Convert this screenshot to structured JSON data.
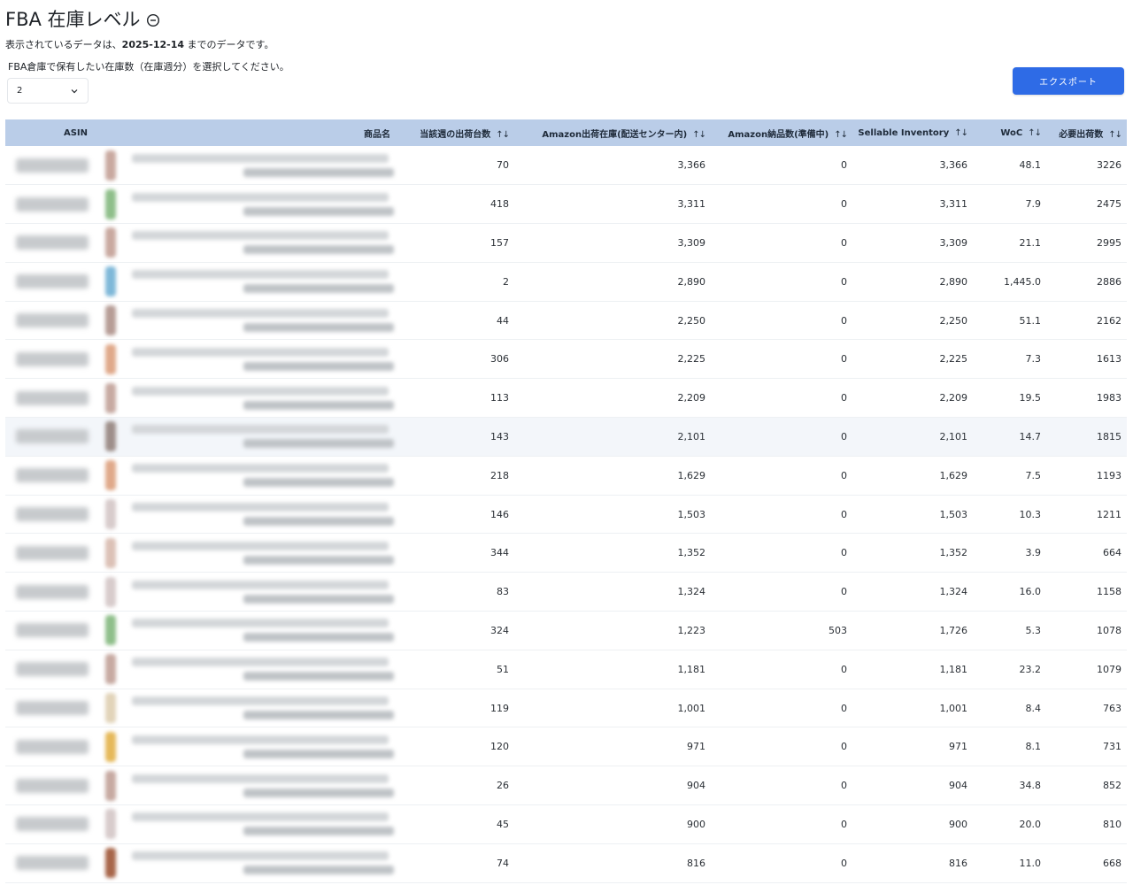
{
  "header": {
    "title": "FBA 在庫レベル",
    "subtitle_prefix": "表示されているデータは、",
    "subtitle_date": "2025-12-14",
    "subtitle_suffix": " までのデータです。",
    "select_label": "FBA倉庫で保有したい在庫数（在庫週分）を選択してください。",
    "select_value": "2"
  },
  "toolbar": {
    "export_label": "エクスポート"
  },
  "colors": {
    "accent": "#2e6be6",
    "header_bg": "#bacde8"
  },
  "table": {
    "columns": [
      {
        "label": "ASIN",
        "sortable": false
      },
      {
        "label": "商品名",
        "sortable": false
      },
      {
        "label": "当該週の出荷台数",
        "sortable": true
      },
      {
        "label": "Amazon出荷在庫(配送センター内)",
        "sortable": true
      },
      {
        "label": "Amazon納品数(準備中)",
        "sortable": true
      },
      {
        "label": "Sellable Inventory",
        "sortable": true
      },
      {
        "label": "WoC",
        "sortable": true
      },
      {
        "label": "必要出荷数",
        "sortable": true
      }
    ],
    "sort_glyph": "↑↓",
    "rows": [
      {
        "thumb": "#c9a9a0",
        "v": [
          "70",
          "3,366",
          "0",
          "3,366",
          "48.1",
          "3226"
        ]
      },
      {
        "thumb": "#8fbf8a",
        "v": [
          "418",
          "3,311",
          "0",
          "3,311",
          "7.9",
          "2475"
        ]
      },
      {
        "thumb": "#c9a9a0",
        "v": [
          "157",
          "3,309",
          "0",
          "3,309",
          "21.1",
          "2995"
        ]
      },
      {
        "thumb": "#7fb8d9",
        "v": [
          "2",
          "2,890",
          "0",
          "2,890",
          "1,445.0",
          "2886"
        ]
      },
      {
        "thumb": "#b79d96",
        "v": [
          "44",
          "2,250",
          "0",
          "2,250",
          "51.1",
          "2162"
        ]
      },
      {
        "thumb": "#e0a98a",
        "v": [
          "306",
          "2,225",
          "0",
          "2,225",
          "7.3",
          "1613"
        ]
      },
      {
        "thumb": "#c7aaa2",
        "v": [
          "113",
          "2,209",
          "0",
          "2,209",
          "19.5",
          "1983"
        ]
      },
      {
        "thumb": "#9e8f8a",
        "v": [
          "143",
          "2,101",
          "0",
          "2,101",
          "14.7",
          "1815"
        ]
      },
      {
        "thumb": "#e0a98a",
        "v": [
          "218",
          "1,629",
          "0",
          "1,629",
          "7.5",
          "1193"
        ]
      },
      {
        "thumb": "#d8cccc",
        "v": [
          "146",
          "1,503",
          "0",
          "1,503",
          "10.3",
          "1211"
        ]
      },
      {
        "thumb": "#dcc1b6",
        "v": [
          "344",
          "1,352",
          "0",
          "1,352",
          "3.9",
          "664"
        ]
      },
      {
        "thumb": "#d8cccc",
        "v": [
          "83",
          "1,324",
          "0",
          "1,324",
          "16.0",
          "1158"
        ]
      },
      {
        "thumb": "#8fbf8a",
        "v": [
          "324",
          "1,223",
          "503",
          "1,726",
          "5.3",
          "1078"
        ]
      },
      {
        "thumb": "#c7aaa2",
        "v": [
          "51",
          "1,181",
          "0",
          "1,181",
          "23.2",
          "1079"
        ]
      },
      {
        "thumb": "#e2d4b9",
        "v": [
          "119",
          "1,001",
          "0",
          "1,001",
          "8.4",
          "763"
        ]
      },
      {
        "thumb": "#e6b95a",
        "v": [
          "120",
          "971",
          "0",
          "971",
          "8.1",
          "731"
        ]
      },
      {
        "thumb": "#c7aaa2",
        "v": [
          "26",
          "904",
          "0",
          "904",
          "34.8",
          "852"
        ]
      },
      {
        "thumb": "#d8cccc",
        "v": [
          "45",
          "900",
          "0",
          "900",
          "20.0",
          "810"
        ]
      },
      {
        "thumb": "#a8664a",
        "v": [
          "74",
          "816",
          "0",
          "816",
          "11.0",
          "668"
        ]
      }
    ]
  }
}
